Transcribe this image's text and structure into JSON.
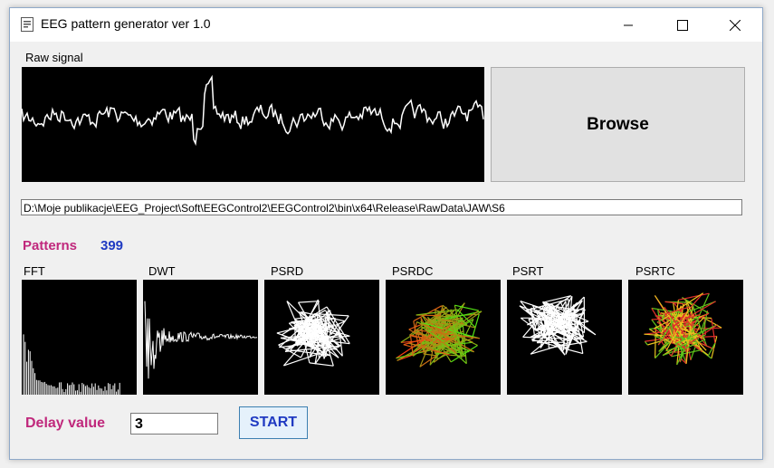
{
  "window": {
    "title": "EEG pattern generator ver 1.0",
    "controls": [
      "minimize-icon",
      "maximize-icon",
      "close-icon"
    ]
  },
  "raw_signal": {
    "label": "Raw signal"
  },
  "browse": {
    "label": "Browse"
  },
  "path": {
    "value": "D:\\Moje publikacje\\EEG_Project\\Soft\\EEGControl2\\EEGControl2\\bin\\x64\\Release\\RawData\\JAW\\S6"
  },
  "patterns": {
    "label": "Patterns",
    "count": "399"
  },
  "panels": [
    {
      "label": "FFT"
    },
    {
      "label": "DWT"
    },
    {
      "label": "PSRD"
    },
    {
      "label": "PSRDC"
    },
    {
      "label": "PSRT"
    },
    {
      "label": "PSRTC"
    }
  ],
  "delay": {
    "label": "Delay value",
    "value": "3"
  },
  "start": {
    "label": "START"
  },
  "colors": {
    "accent_pink": "#c0287c",
    "accent_blue": "#1f3ac2",
    "panel_bg": "#000000"
  }
}
